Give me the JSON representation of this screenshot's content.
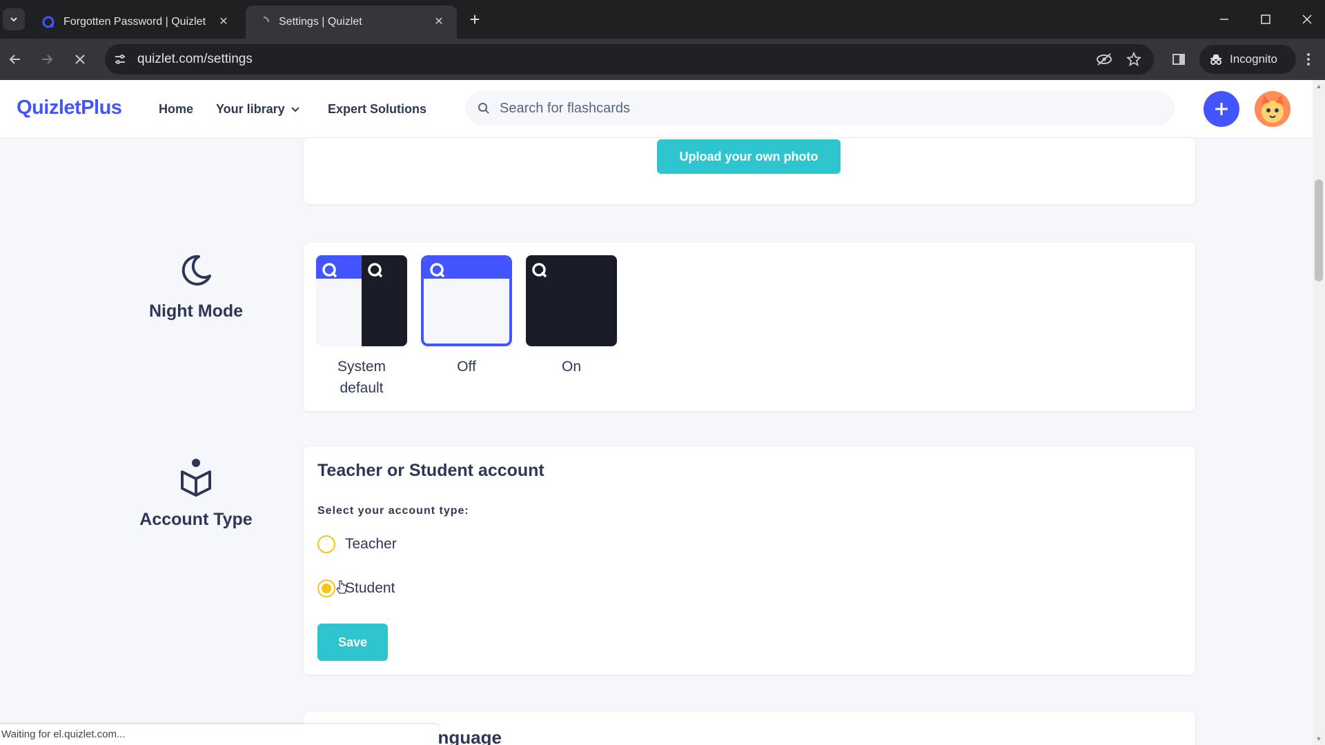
{
  "browser": {
    "tabs": [
      {
        "title": "Forgotten Password | Quizlet",
        "active": false
      },
      {
        "title": "Settings | Quizlet",
        "active": true
      }
    ],
    "url": "quizlet.com/settings",
    "incognito_label": "Incognito",
    "status_text": "Waiting for el.quizlet.com..."
  },
  "header": {
    "logo": "QuizletPlus",
    "nav": {
      "home": "Home",
      "library": "Your library",
      "expert": "Expert Solutions"
    },
    "search_placeholder": "Search for flashcards"
  },
  "profile_photo": {
    "upload_label": "Upload your own photo"
  },
  "night_mode": {
    "label": "Night Mode",
    "options": [
      {
        "label": "System default",
        "selected": false
      },
      {
        "label": "Off",
        "selected": true
      },
      {
        "label": "On",
        "selected": false
      }
    ]
  },
  "account_type": {
    "label": "Account Type",
    "title": "Teacher or Student account",
    "subtitle": "Select your account type:",
    "options": [
      {
        "label": "Teacher",
        "selected": false
      },
      {
        "label": "Student",
        "selected": true
      }
    ],
    "save_label": "Save"
  },
  "next_section_partial": "anguage",
  "colors": {
    "brand": "#4255ff",
    "teal": "#2ec5ce",
    "radio": "#f5c518",
    "dark": "#1a1d28"
  }
}
